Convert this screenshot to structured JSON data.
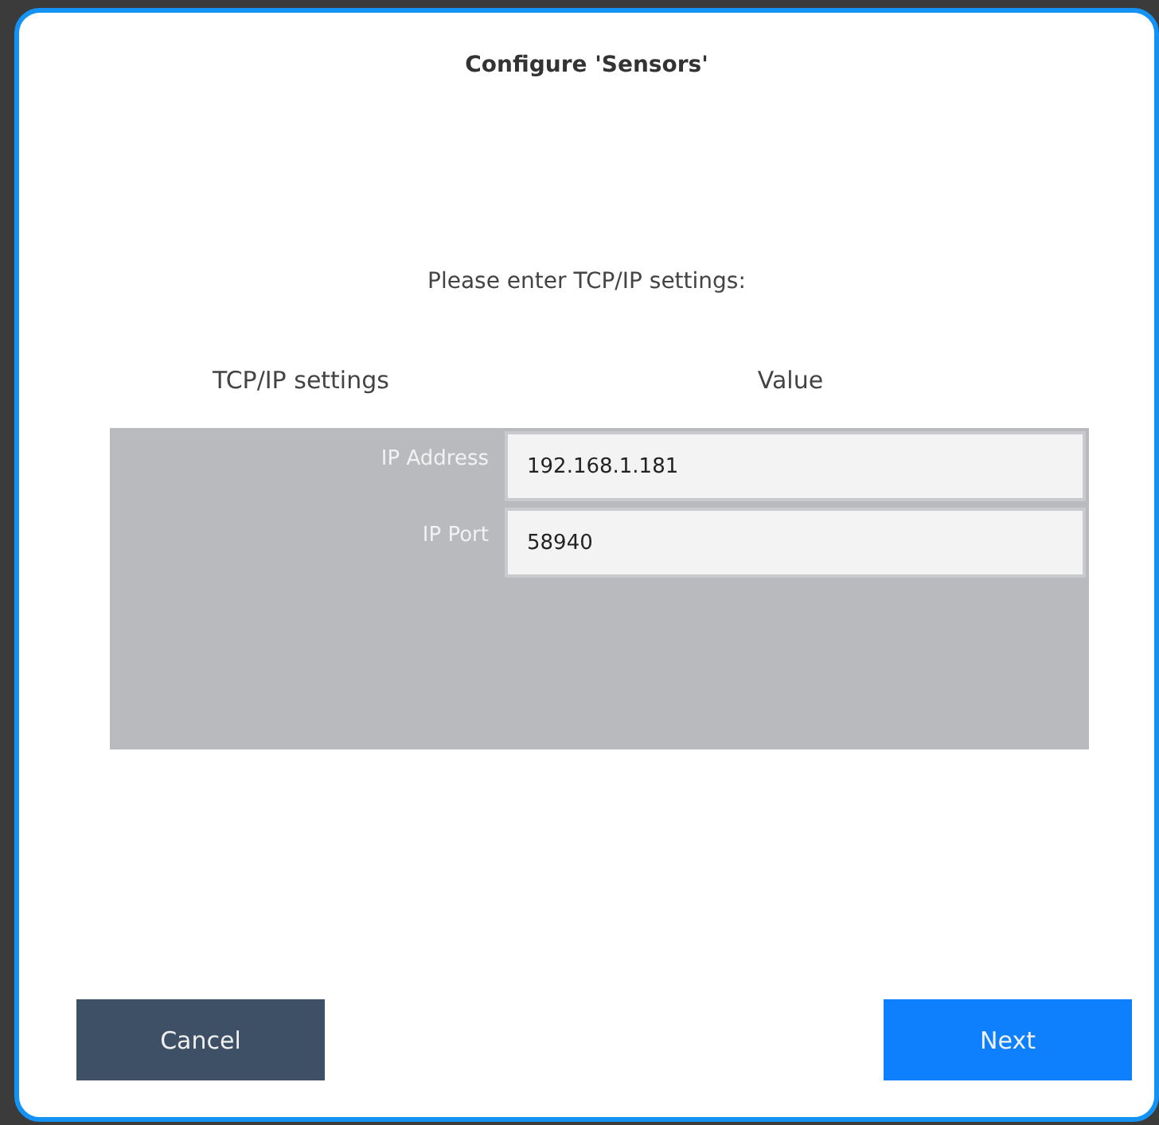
{
  "dialog": {
    "title": "Configure 'Sensors'",
    "prompt": "Please enter TCP/IP settings:"
  },
  "table": {
    "columns": [
      "TCP/IP settings",
      "Value"
    ],
    "rows": [
      {
        "label": "IP Address",
        "value": "192.168.1.181"
      },
      {
        "label": "IP Port",
        "value": "58940"
      }
    ]
  },
  "buttons": [
    {
      "label": "Cancel",
      "kind": "secondary"
    },
    {
      "label": "Next",
      "kind": "primary"
    }
  ]
}
